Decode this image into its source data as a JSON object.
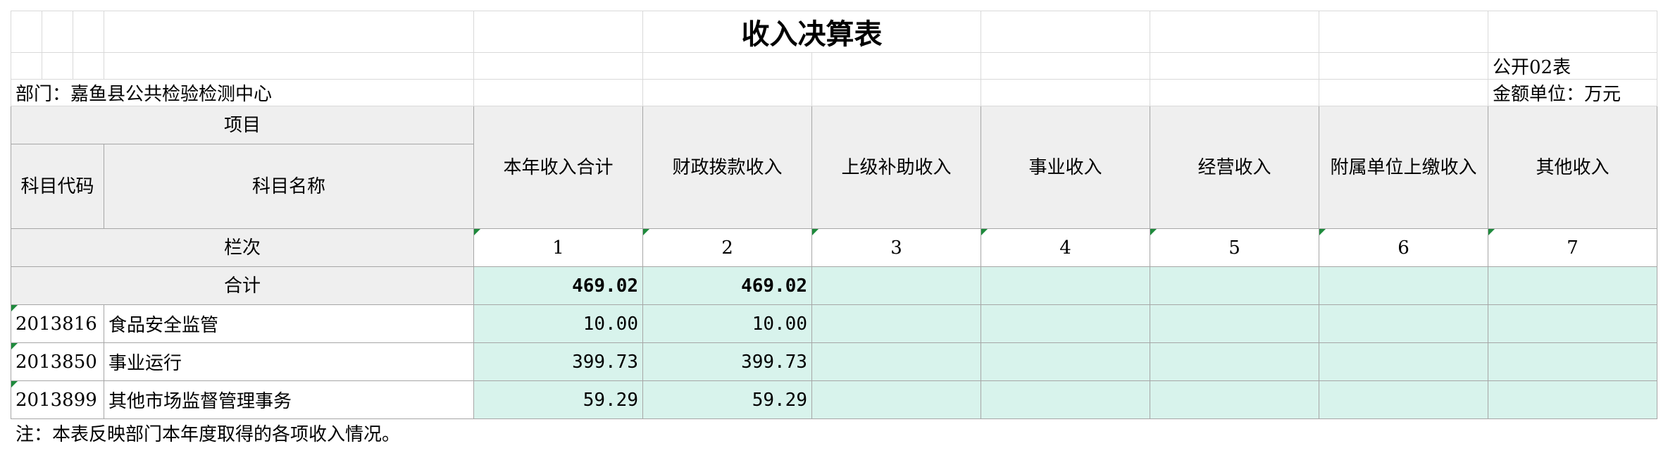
{
  "title": "收入决算表",
  "form_code": "公开02表",
  "department": "部门：嘉鱼县公共检验检测中心",
  "unit": "金额单位：万元",
  "headers": {
    "item": "项目",
    "code": "科目代码",
    "name": "科目名称",
    "columns": [
      "本年收入合计",
      "财政拨款收入",
      "上级补助收入",
      "事业收入",
      "经营收入",
      "附属单位上缴收入",
      "其他收入"
    ],
    "index_label": "栏次",
    "index_numbers": [
      "1",
      "2",
      "3",
      "4",
      "5",
      "6",
      "7"
    ]
  },
  "total": {
    "label": "合计",
    "values": [
      "469.02",
      "469.02",
      "",
      "",
      "",
      "",
      ""
    ]
  },
  "rows": [
    {
      "code": "2013816",
      "name": "食品安全监管",
      "values": [
        "10.00",
        "10.00",
        "",
        "",
        "",
        "",
        ""
      ]
    },
    {
      "code": "2013850",
      "name": "事业运行",
      "values": [
        "399.73",
        "399.73",
        "",
        "",
        "",
        "",
        ""
      ]
    },
    {
      "code": "2013899",
      "name": "其他市场监督管理事务",
      "values": [
        "59.29",
        "59.29",
        "",
        "",
        "",
        "",
        ""
      ]
    }
  ],
  "note": "注：本表反映部门本年度取得的各项收入情况。"
}
